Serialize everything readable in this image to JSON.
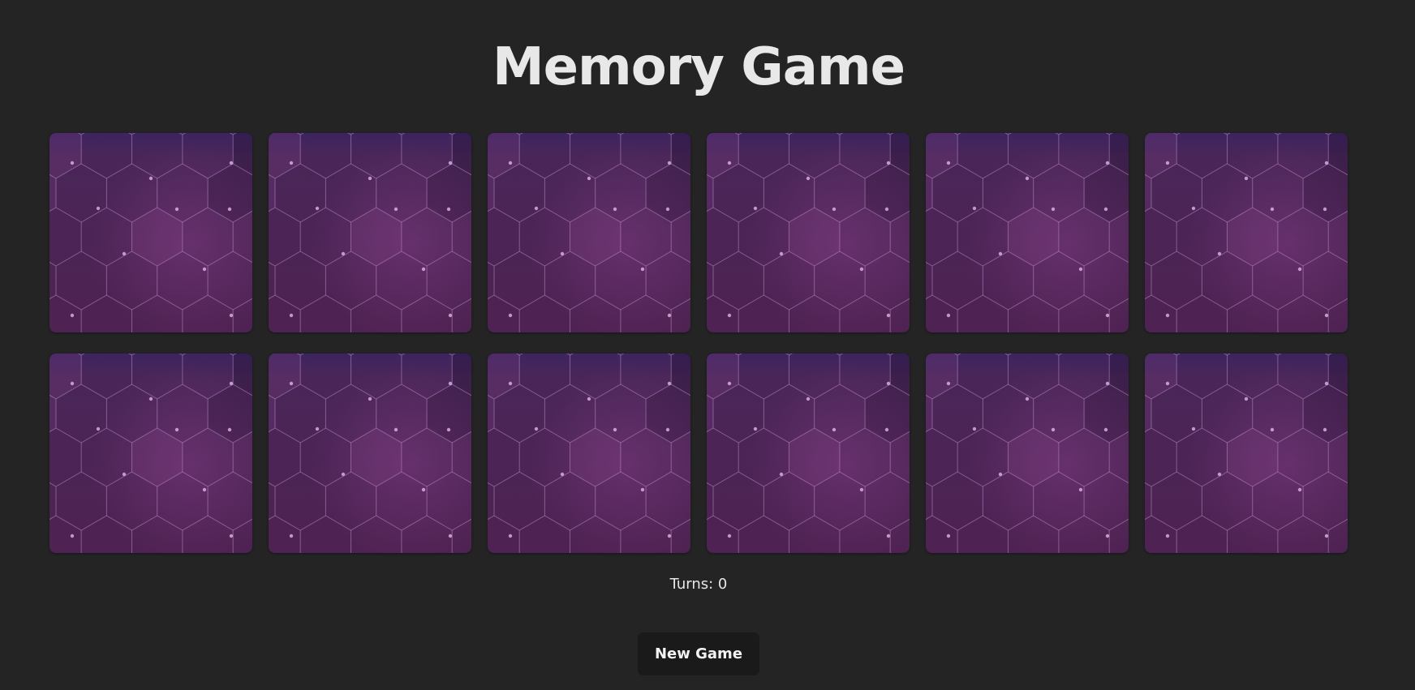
{
  "title": "Memory Game",
  "cards": [
    {
      "state": "face-down"
    },
    {
      "state": "face-down"
    },
    {
      "state": "face-down"
    },
    {
      "state": "face-down"
    },
    {
      "state": "face-down"
    },
    {
      "state": "face-down"
    },
    {
      "state": "face-down"
    },
    {
      "state": "face-down"
    },
    {
      "state": "face-down"
    },
    {
      "state": "face-down"
    },
    {
      "state": "face-down"
    },
    {
      "state": "face-down"
    }
  ],
  "card_back": {
    "base_color": "#4e2353",
    "pattern": "hexagon-network"
  },
  "status": {
    "turns_label": "Turns: 0"
  },
  "controls": {
    "new_game_label": "New Game"
  },
  "colors": {
    "background": "#242424",
    "button_bg": "#1a1a1a",
    "text": "#e6e6e6"
  }
}
